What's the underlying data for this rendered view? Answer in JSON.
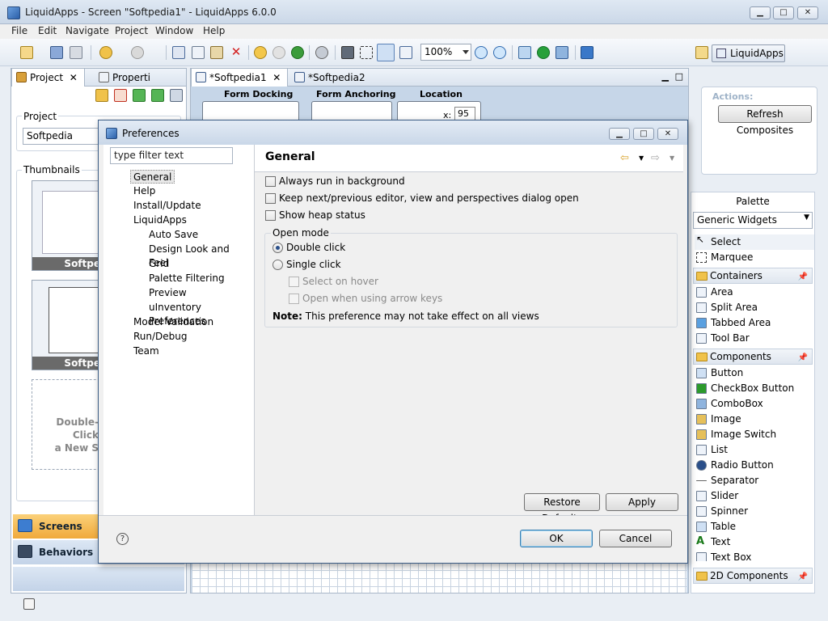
{
  "window": {
    "title": "LiquidApps - Screen \"Softpedia1\" - LiquidApps 6.0.0",
    "minimize": "▁",
    "maximize": "□",
    "close": "✕"
  },
  "menu": [
    "File",
    "Edit",
    "Navigate",
    "Project",
    "Window",
    "Help"
  ],
  "toolbar": {
    "zoom": "100%",
    "perspective": "LiquidApps"
  },
  "left_panel": {
    "tabs": [
      "Project",
      "Properti"
    ],
    "project_label": "Project",
    "project_value": "Softpedia",
    "thumbnails_label": "Thumbnails",
    "thumbs": [
      "Softpe",
      "Softpe"
    ],
    "new_screen_hint": "Double-Click\na New S",
    "nav": [
      "Screens",
      "Behaviors"
    ]
  },
  "editor": {
    "tabs": [
      "*Softpedia1",
      "*Softpedia2"
    ],
    "form_docking": "Form Docking",
    "form_anchoring": "Form Anchoring",
    "location": "Location",
    "x_label": "x:",
    "x_value": "95"
  },
  "actions": {
    "label": "Actions:",
    "refresh": "Refresh Composites"
  },
  "palette": {
    "title": "Palette",
    "set": "Generic Widgets",
    "tools": [
      "Select",
      "Marquee"
    ],
    "categories": [
      {
        "name": "Containers",
        "items": [
          "Area",
          "Split Area",
          "Tabbed Area",
          "Tool Bar"
        ]
      },
      {
        "name": "Components",
        "items": [
          "Button",
          "CheckBox Button",
          "ComboBox",
          "Image",
          "Image Switch",
          "List",
          "Radio Button",
          "Separator",
          "Slider",
          "Spinner",
          "Table",
          "Text",
          "Text Box"
        ]
      },
      {
        "name": "2D Components",
        "items": []
      }
    ]
  },
  "dialog": {
    "title": "Preferences",
    "filter_placeholder": "type filter text",
    "tree": [
      {
        "label": "General",
        "level": 0,
        "selected": true
      },
      {
        "label": "Help",
        "level": 0
      },
      {
        "label": "Install/Update",
        "level": 0
      },
      {
        "label": "LiquidApps",
        "level": 0
      },
      {
        "label": "Auto Save",
        "level": 1
      },
      {
        "label": "Design Look and Feel",
        "level": 1
      },
      {
        "label": "Grid",
        "level": 1
      },
      {
        "label": "Palette Filtering",
        "level": 1
      },
      {
        "label": "Preview",
        "level": 1
      },
      {
        "label": "uInventory Preferences",
        "level": 1
      },
      {
        "label": "Model Validation",
        "level": 0
      },
      {
        "label": "Run/Debug",
        "level": 0
      },
      {
        "label": "Team",
        "level": 0
      }
    ],
    "page_title": "General",
    "checks": [
      {
        "label": "Always run in background",
        "checked": false
      },
      {
        "label": "Keep next/previous editor, view and perspectives dialog open",
        "checked": false
      },
      {
        "label": "Show heap status",
        "checked": false
      }
    ],
    "open_mode": {
      "legend": "Open mode",
      "double": "Double click",
      "single": "Single click",
      "select_on_hover": "Select on hover",
      "open_arrow_keys": "Open when using arrow keys",
      "selected": "double"
    },
    "note_label": "Note:",
    "note_text": "This preference may not take effect on all views",
    "restore_defaults": "Restore Defaults",
    "apply": "Apply",
    "ok": "OK",
    "cancel": "Cancel",
    "help": "?"
  }
}
